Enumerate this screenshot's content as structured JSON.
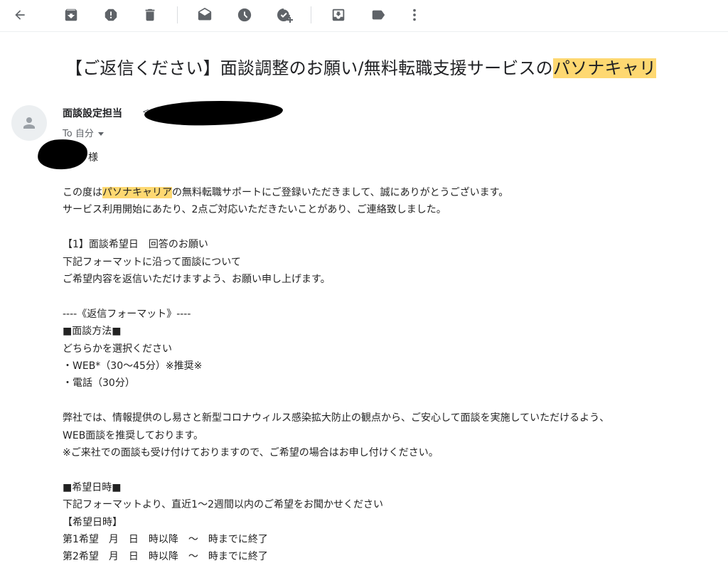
{
  "toolbar": {
    "buttons": [
      {
        "name": "back-icon"
      },
      {
        "name": "archive-icon"
      },
      {
        "name": "report-spam-icon"
      },
      {
        "name": "delete-icon"
      },
      {
        "name": "mark-unread-icon"
      },
      {
        "name": "snooze-icon"
      },
      {
        "name": "add-to-tasks-icon"
      },
      {
        "name": "move-to-icon"
      },
      {
        "name": "label-icon"
      },
      {
        "name": "more-options-icon"
      }
    ]
  },
  "email": {
    "subject_pre": "【ご返信ください】面談調整のお願い/無料転職支援サービスの",
    "subject_highlight": "パソナキャリ",
    "sender_name": "面談設定担当",
    "sender_email_fragment": "<",
    "to_label": "To 自分",
    "greeting": "様",
    "body": {
      "l1_pre": "この度は",
      "l1_highlight": "パソナキャリア",
      "l1_post": "の無料転職サポートにご登録いただきまして、誠にありがとうございます。",
      "l2": "サービス利用開始にあたり、2点ご対応いただきたいことがあり、ご連絡致しました。",
      "l3": "【1】面談希望日　回答のお願い",
      "l4": "下記フォーマットに沿って面談について",
      "l5": "ご希望内容を返信いただけますよう、お願い申し上げます。",
      "l6": "----《返信フォーマット》----",
      "l7": "■面談方法■",
      "l8": "どちらかを選択ください",
      "l9": "・WEB*（30～45分）※推奨※",
      "l10": "・電話（30分）",
      "l11": "弊社では、情報提供のし易さと新型コロナウィルス感染拡大防止の観点から、ご安心して面談を実施していただけるよう、",
      "l12": "WEB面談を推奨しております。",
      "l13": "※ご来社での面談も受け付けておりますので、ご希望の場合はお申し付けください。",
      "l14": "■希望日時■",
      "l15": "下記フォーマットより、直近1～2週間以内のご希望をお聞かせください",
      "l16": "【希望日時】",
      "l17": "第1希望　月　日　時以降　～　時までに終了",
      "l18": "第2希望　月　日　時以降　～　時までに終了"
    }
  },
  "colors": {
    "highlight": "#fed871",
    "icon": "#5f6368",
    "text": "#202124"
  }
}
